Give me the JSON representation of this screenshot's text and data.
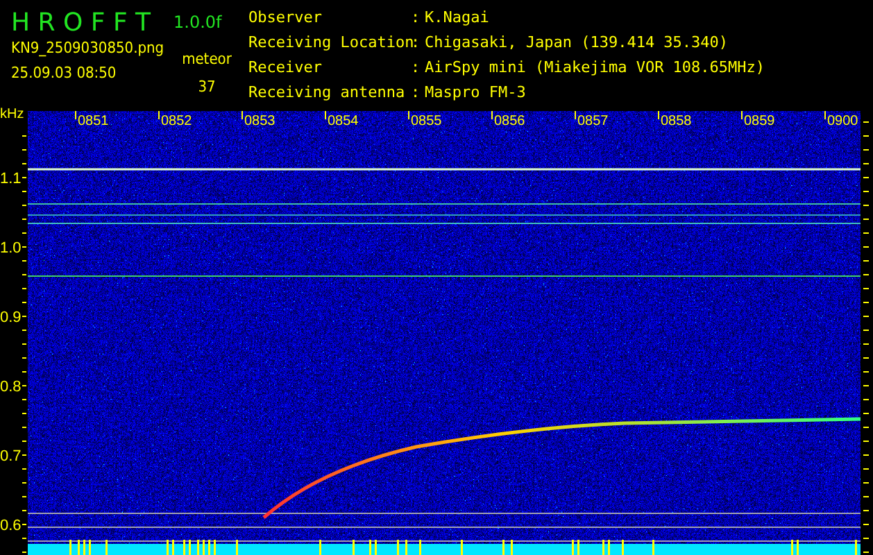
{
  "header": {
    "app_name": "H R O F F T",
    "version": "1.0.0f",
    "filename": "KN9_2509030850.png",
    "timestamp": "25.09.03 08:50",
    "event_type": "meteor",
    "event_count": "37"
  },
  "station": [
    {
      "label": "Observer",
      "separator": ":",
      "value": "K.Nagai"
    },
    {
      "label": "Receiving Location",
      "separator": ":",
      "value": "Chigasaki, Japan (139.414 35.340)"
    },
    {
      "label": "Receiver",
      "separator": ":",
      "value": "AirSpy mini (Miakejima VOR 108.65MHz)"
    },
    {
      "label": "Receiving antenna",
      "separator": ":",
      "value": "Maspro FM-3"
    }
  ],
  "spectrogram": {
    "unit_label": "kHz",
    "y_labels": [
      "1.1",
      "1.0",
      "0.9",
      "0.8",
      "0.7",
      "0.6"
    ],
    "time_labels": [
      "0851",
      "0852",
      "0853",
      "0854",
      "0855",
      "0856",
      "0857",
      "0858",
      "0859",
      "0900"
    ]
  }
}
